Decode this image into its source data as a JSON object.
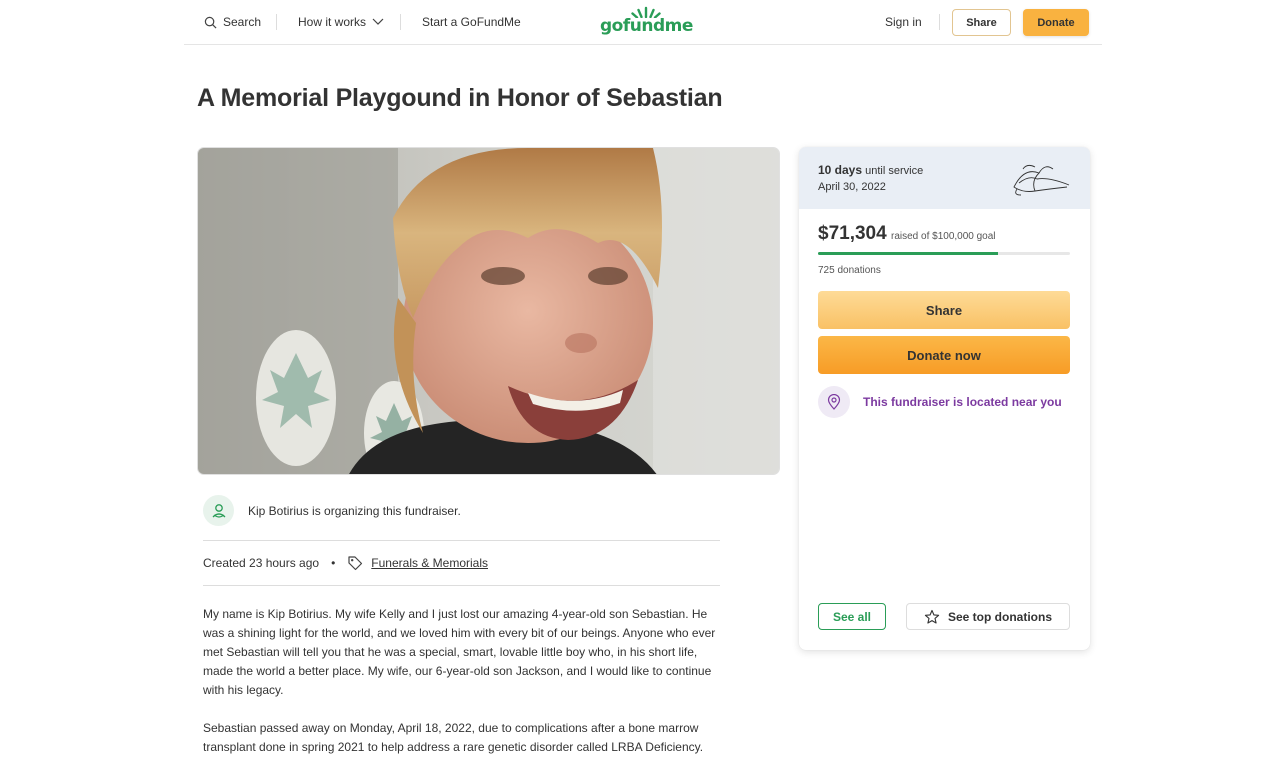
{
  "header": {
    "search_label": "Search",
    "how_label": "How it works",
    "start_label": "Start a GoFundMe",
    "logo_text": "gofundme",
    "signin_label": "Sign in",
    "share_label": "Share",
    "donate_label": "Donate"
  },
  "campaign": {
    "title": "A Memorial Playgound in Honor of Sebastian",
    "organizer_text": "Kip Botirius is organizing this fundraiser.",
    "created_text": "Created 23 hours ago",
    "category": "Funerals & Memorials",
    "story": [
      "My name is Kip Botirius. My wife Kelly and I just lost our amazing 4-year-old son Sebastian. He was a shining light for the world, and we loved him with every bit of our beings. Anyone who ever met Sebastian will tell you that he was a special, smart, lovable little boy who, in his short life, made the world a better place. My wife, our 6-year-old son Jackson, and I would like to continue with his legacy.",
      "Sebastian passed away on Monday, April 18, 2022, due to complications after a bone marrow transplant done in spring 2021 to help address a rare genetic disorder called LRBA Deficiency."
    ]
  },
  "sidebar": {
    "days_count": "10 days",
    "days_suffix": "until service",
    "service_date": "April 30, 2022",
    "raised": "$71,304",
    "goal_text": "raised of $100,000 goal",
    "progress_fraction": 0.713,
    "donations": "725 donations",
    "share_label": "Share",
    "donate_label": "Donate now",
    "near_text": "This fundraiser is located near you",
    "see_all_label": "See all",
    "see_top_label": "See top donations"
  },
  "colors": {
    "brand_green": "#2a9d57",
    "donate_orange": "#f9b240",
    "near_purple": "#7c3aa0"
  },
  "icons": [
    "search-icon",
    "chevron-down-icon",
    "gofundme-sprout-icon",
    "lily-flower-icon",
    "organizer-icon",
    "tag-icon",
    "location-pin-icon",
    "star-icon"
  ]
}
